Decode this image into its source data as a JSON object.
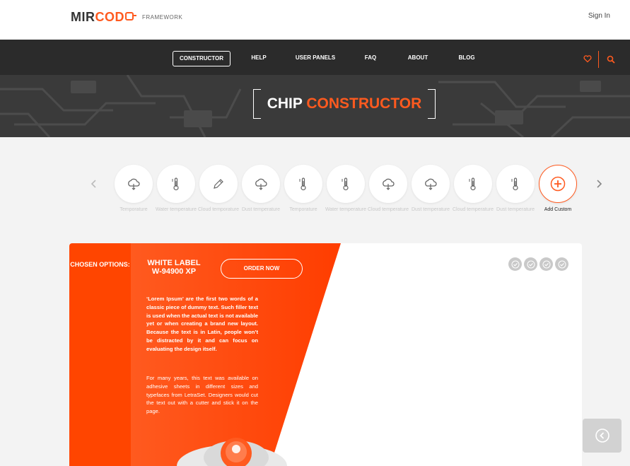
{
  "header": {
    "logo": {
      "part1": "MIR",
      "part2": "COD",
      "subtitle": "FRAMEWORK"
    },
    "signin_label": "Sign In"
  },
  "nav": {
    "items": [
      {
        "label": "CONSTRUCTOR",
        "active": true
      },
      {
        "label": "HELP"
      },
      {
        "label": "USER PANELS"
      },
      {
        "label": "FAQ"
      },
      {
        "label": "ABOUT"
      },
      {
        "label": "BLOG"
      }
    ],
    "icons": [
      "heart-icon",
      "search-icon"
    ]
  },
  "hero": {
    "title_white": "CHIP",
    "title_orange": "CONSTRUCTOR"
  },
  "carousel": {
    "items": [
      {
        "label": "Temporature",
        "icon": "cloud-icon"
      },
      {
        "label": "Water temperature",
        "icon": "thermometer-icon"
      },
      {
        "label": "Cloud temporature",
        "icon": "pencil-icon"
      },
      {
        "label": "Dust temperature",
        "icon": "cloud-icon"
      },
      {
        "label": "Temporature",
        "icon": "thermometer-icon"
      },
      {
        "label": "Water temperature",
        "icon": "thermometer-icon"
      },
      {
        "label": "Cloud temperature",
        "icon": "cloud-icon"
      },
      {
        "label": "Dust temperature",
        "icon": "cloud-icon"
      },
      {
        "label": "Cloud temperature",
        "icon": "thermometer-icon"
      },
      {
        "label": "Dust temperature",
        "icon": "thermometer-icon"
      }
    ],
    "add_label": "Add Custom"
  },
  "card": {
    "chosen_label": "CHOSEN OPTIONS:",
    "title": "WHITE LABEL W-94900 XP",
    "order_label": "ORDER NOW",
    "paragraph1": "‘Lorem Ipsum’ are the first two words of a classic piece of dummy text. Such filler text is used when the actual text is not available yet or when creating a brand new layout. Because the text is in Latin, people won’t be distracted by it and can focus on evaluating the design itself.",
    "paragraph2": "For many years, this text was available on adhesive sheets in different sizes and typefaces from LetraSet. Designers would cut the text out with a cutter and stick it on the page.",
    "check_count": 4
  },
  "colors": {
    "accent": "#ff5a1f",
    "nav_bg": "#2b2b2b",
    "card_orange": "#ff4500"
  }
}
